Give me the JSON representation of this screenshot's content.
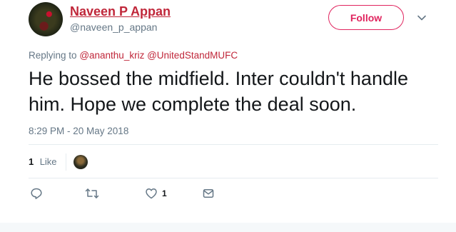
{
  "user": {
    "display_name": "Naveen P Appan",
    "screen_name": "@naveen_p_appan"
  },
  "follow_label": "Follow",
  "replying": {
    "prefix": "Replying to",
    "mentions": [
      "@ananthu_kriz",
      "@UnitedStandMUFC"
    ]
  },
  "tweet_text": "He bossed the midfield. Inter couldn't handle him. Hope we complete the deal soon.",
  "timestamp": "8:29 PM - 20 May 2018",
  "likes": {
    "count": "1",
    "label": "Like"
  },
  "actions": {
    "reply_count": "",
    "retweet_count": "",
    "like_count": "1"
  },
  "colors": {
    "accent": "#c0273a",
    "follow": "#e0245e",
    "muted": "#657786"
  },
  "icons": [
    "caret-down-icon",
    "reply-icon",
    "retweet-icon",
    "heart-icon",
    "direct-message-icon"
  ]
}
